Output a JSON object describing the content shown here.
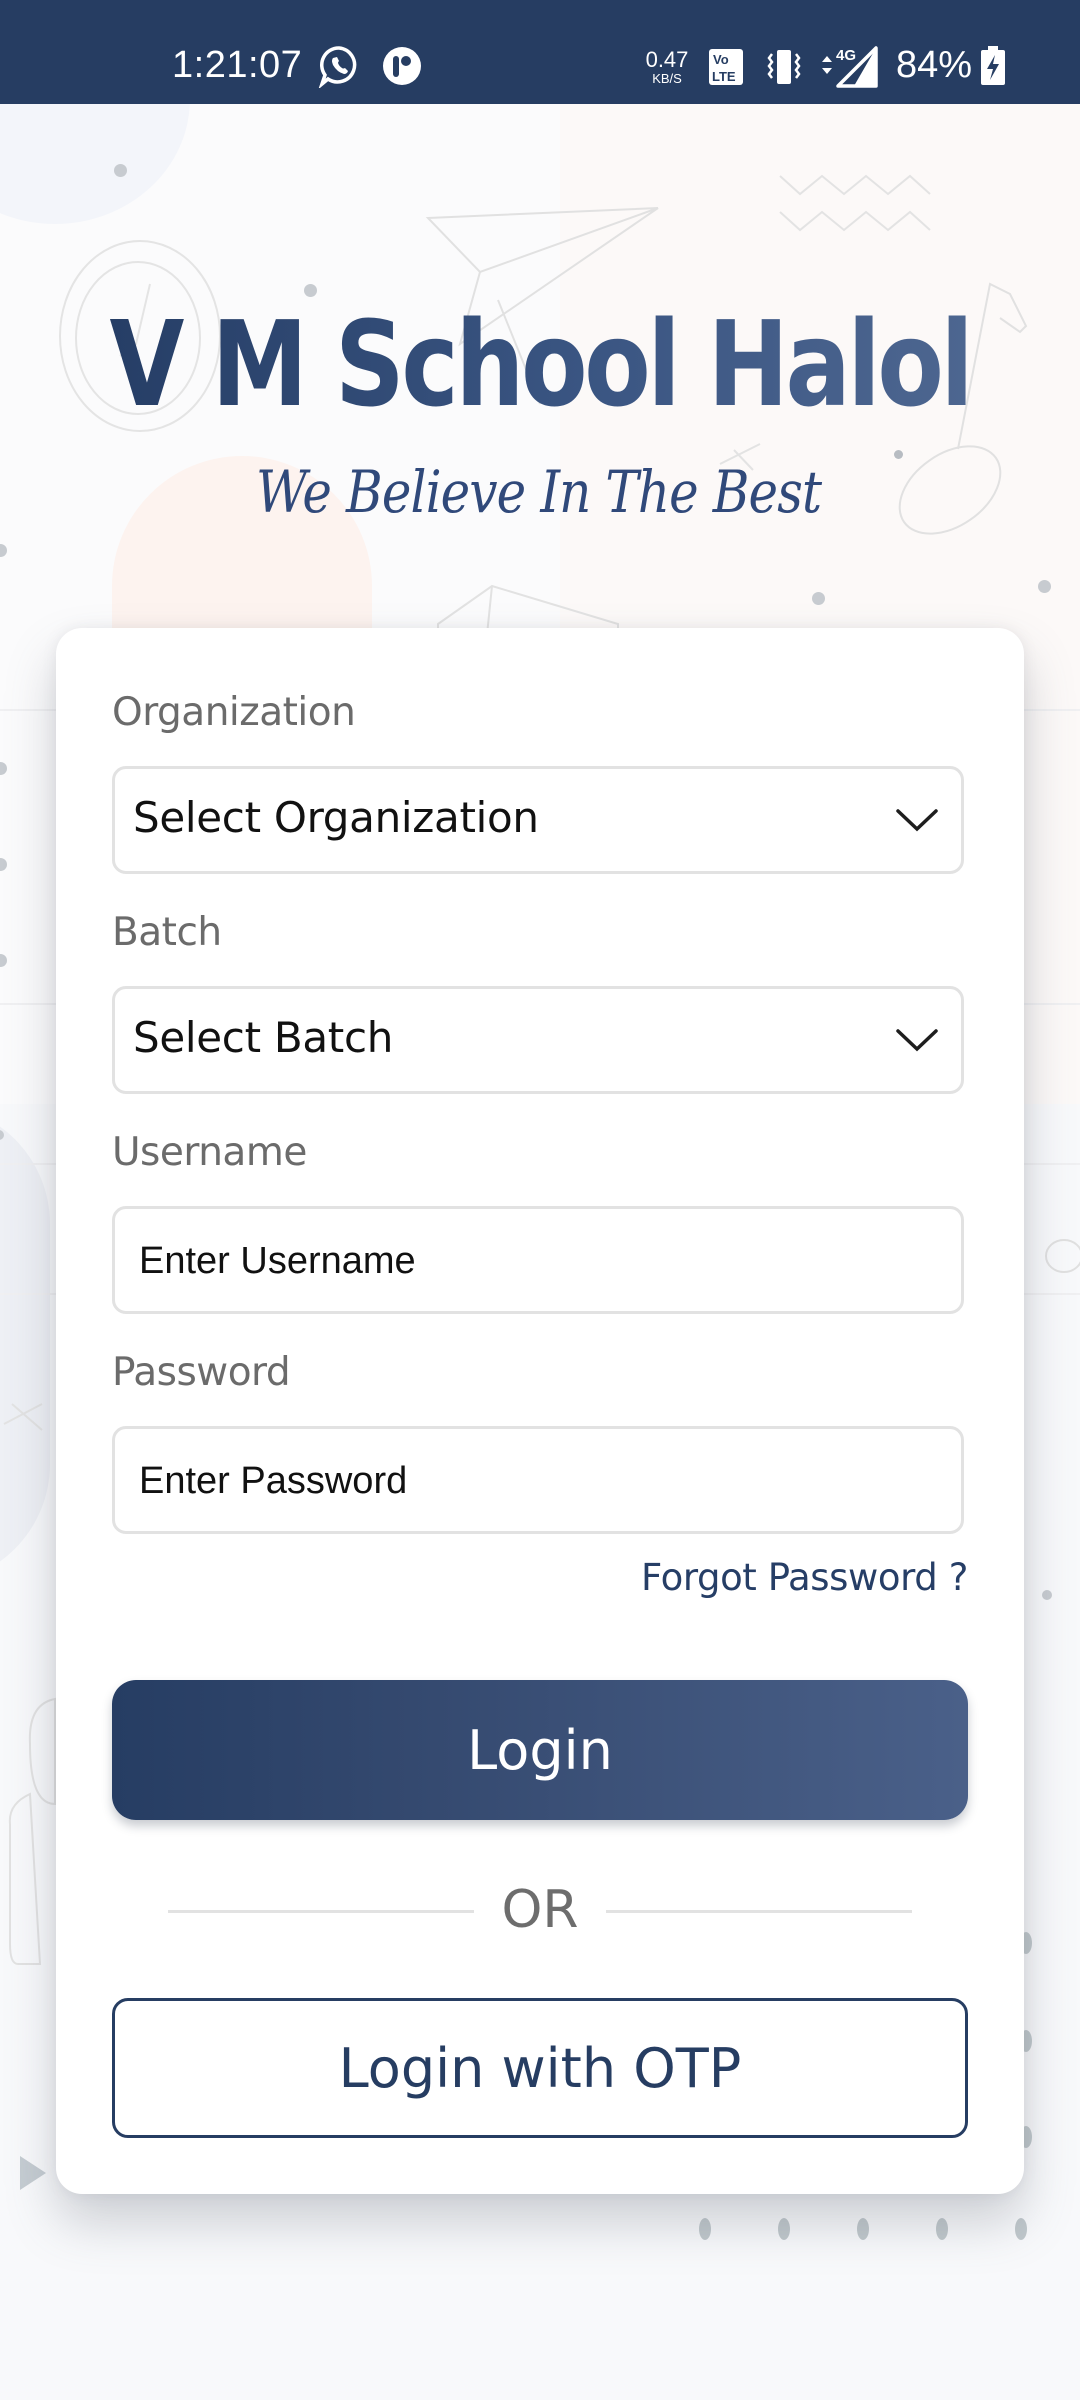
{
  "status_bar": {
    "time": "1:21:07",
    "notification_icons": [
      "whatsapp-icon",
      "app-notification-icon"
    ],
    "network_speed_value": "0.47",
    "network_speed_unit": "KB/S",
    "system_icons": [
      "volte-icon",
      "vibrate-icon",
      "4g-signal-icon"
    ],
    "network_type": "4G",
    "battery_percent": "84%",
    "battery_state": "charging"
  },
  "header": {
    "school_name": "V M School Halol",
    "tagline": "We Believe In The Best"
  },
  "form": {
    "organization": {
      "label": "Organization",
      "selected": "Select Organization"
    },
    "batch": {
      "label": "Batch",
      "selected": "Select Batch"
    },
    "username": {
      "label": "Username",
      "value": "",
      "placeholder": "Enter Username"
    },
    "password": {
      "label": "Password",
      "value": "",
      "placeholder": "Enter Password"
    },
    "forgot_password": "Forgot Password ?",
    "login_button": "Login",
    "divider_text": "OR",
    "otp_button": "Login with OTP"
  },
  "colors": {
    "primary": "#263d62",
    "status_bar": "#263d62",
    "label_gray": "#6b6b6b",
    "border_gray": "#e2e2e2"
  }
}
